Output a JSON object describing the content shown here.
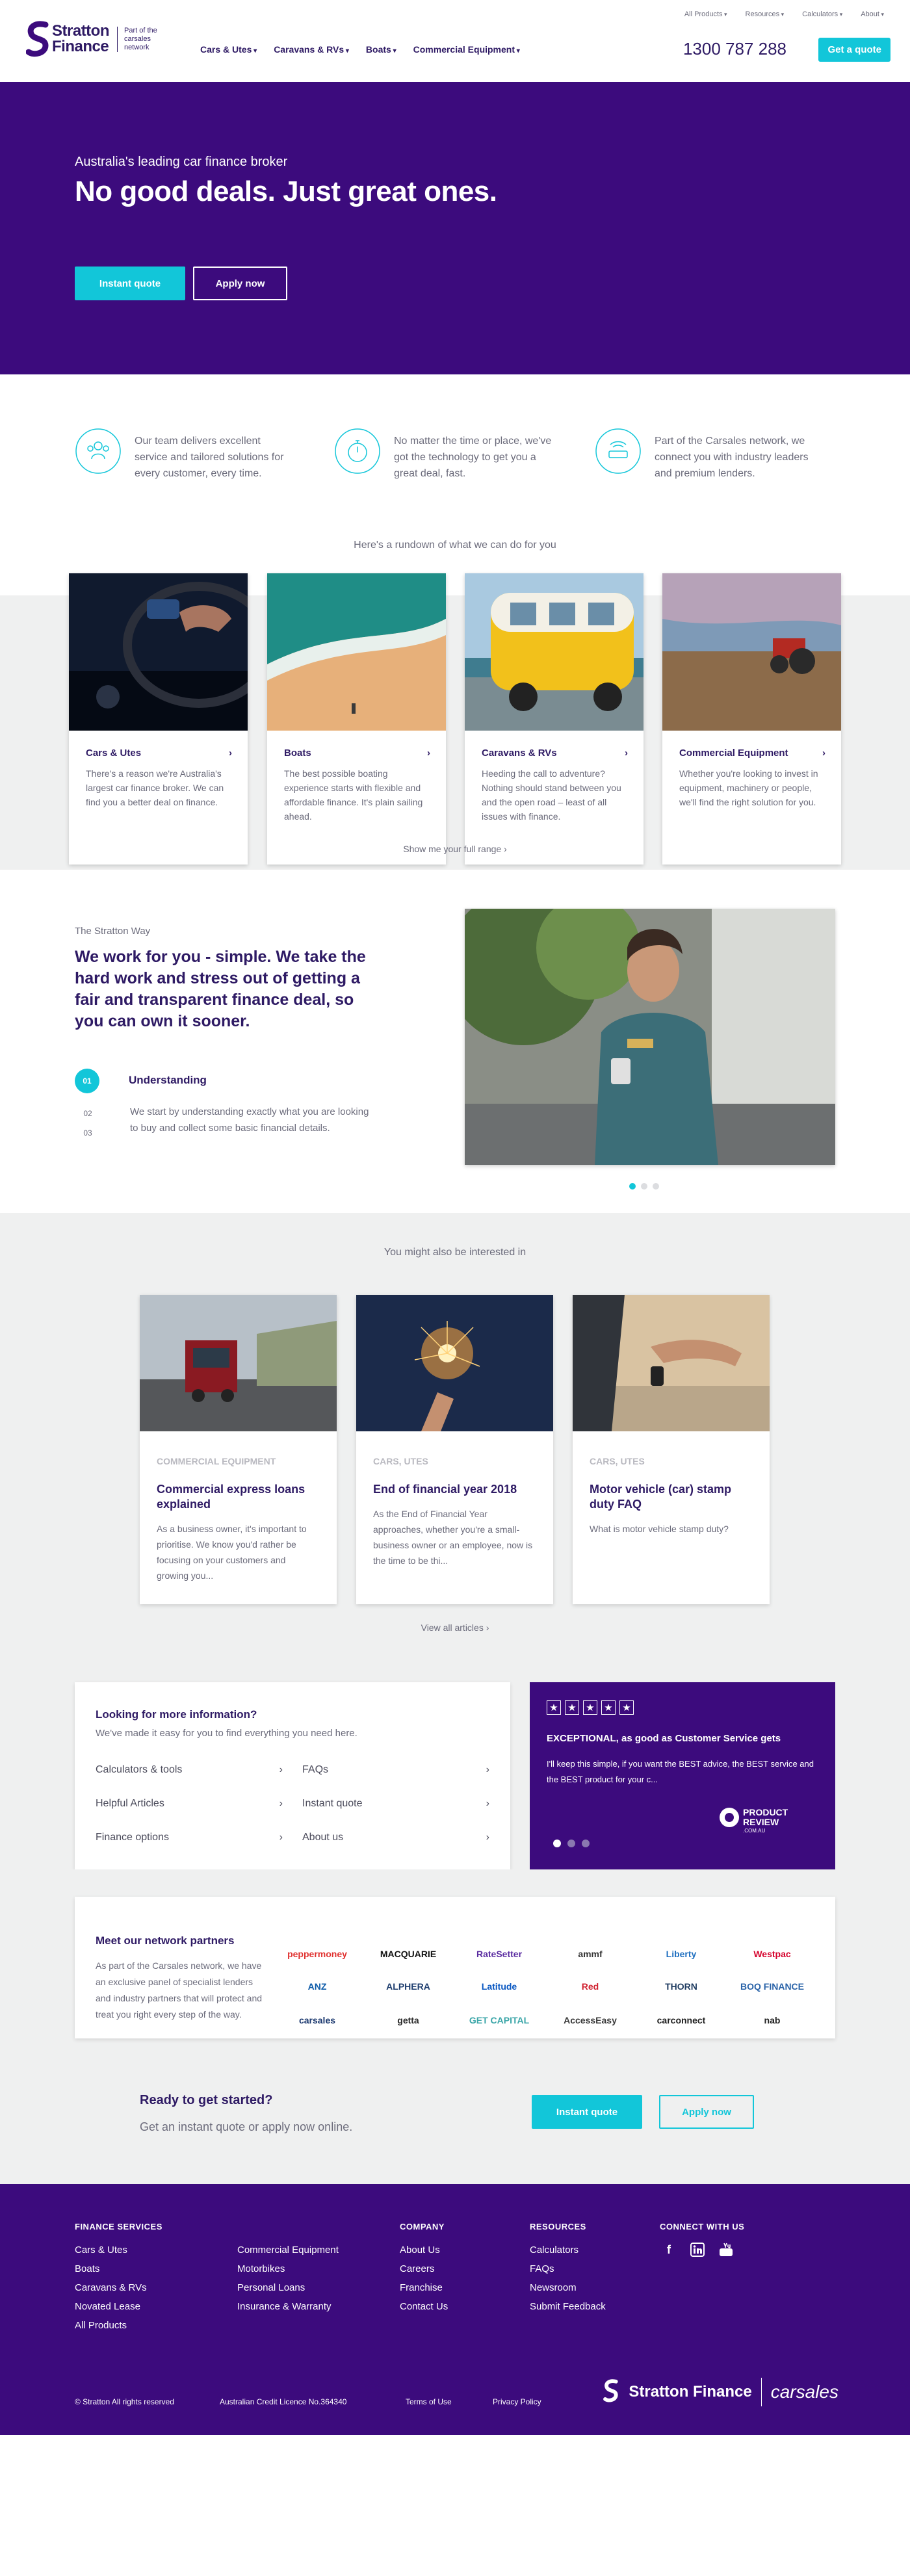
{
  "header": {
    "utility": [
      "All Products",
      "Resources",
      "Calculators",
      "About"
    ],
    "logo_text_1": "Stratton",
    "logo_text_2": "Finance",
    "logo_sub": "Part of the carsales network",
    "nav": [
      {
        "label": "Cars & Utes"
      },
      {
        "label": "Caravans & RVs"
      },
      {
        "label": "Boats"
      },
      {
        "label": "Commercial Equipment"
      }
    ],
    "phone": "1300 787 288",
    "cta": "Get a quote"
  },
  "hero": {
    "kicker": "Australia's leading car finance broker",
    "title": "No good deals. Just great ones.",
    "btn_quote": "Instant quote",
    "btn_apply": "Apply now"
  },
  "features": [
    {
      "icon": "team-icon",
      "text": "Our team delivers excellent service and tailored solutions for every customer, every time."
    },
    {
      "icon": "stopwatch-icon",
      "text": "No matter the time or place, we've got the technology to get you a great deal, fast."
    },
    {
      "icon": "network-icon",
      "text": "Part of the Carsales network, we connect you with industry leaders and premium lenders."
    }
  ],
  "rundown": {
    "title": "Here's a rundown of what we can do for you",
    "cards": [
      {
        "title": "Cars & Utes",
        "desc": "There's a reason we're Australia's largest car finance broker. We can find you a better deal on finance."
      },
      {
        "title": "Boats",
        "desc": "The best possible boating experience starts with flexible and affordable finance. It's plain sailing ahead."
      },
      {
        "title": "Caravans & RVs",
        "desc": "Heeding the call to adventure? Nothing should stand between you and the open road – least of all issues with finance."
      },
      {
        "title": "Commercial Equipment",
        "desc": "Whether you're looking to invest in equipment, machinery or people, we'll find the right solution for you."
      }
    ],
    "more": "Show me your full range ›"
  },
  "way": {
    "kicker": "The Stratton Way",
    "title": "We work for you - simple. We take the hard work and stress out of getting a fair and transparent finance deal, so you can own it sooner.",
    "steps": [
      "01",
      "02",
      "03"
    ],
    "step_title": "Understanding",
    "step_desc": "We start by understanding exactly what you are looking to buy and collect some basic financial details."
  },
  "articles": {
    "title": "You might also be interested in",
    "cards": [
      {
        "tag": "COMMERCIAL EQUIPMENT",
        "title": "Commercial express loans explained",
        "desc": "As a business owner, it's important to prioritise. We know you'd rather be focusing on your customers and growing you..."
      },
      {
        "tag": "CARS, UTES",
        "title": "End of financial year 2018",
        "desc": "As the End of Financial Year approaches, whether you're a small-business owner or an employee, now is the time to be thi..."
      },
      {
        "tag": "CARS, UTES",
        "title": "Motor vehicle (car) stamp duty FAQ",
        "desc": "What is motor vehicle stamp duty?"
      }
    ],
    "view_all": "View all articles ›"
  },
  "info": {
    "title": "Looking for more information?",
    "sub": "We've made it easy for you to find everything you need here.",
    "links": [
      "Calculators & tools",
      "FAQs",
      "Helpful Articles",
      "Instant quote",
      "Finance options",
      "About us"
    ]
  },
  "review": {
    "title": "EXCEPTIONAL, as good as Customer Service gets",
    "text": "I'll keep this simple, if you want the BEST advice, the BEST service and the BEST product for your c...",
    "pr_1": "PRODUCT",
    "pr_2": "REVIEW",
    "pr_3": ".COM.AU"
  },
  "partners": {
    "title": "Meet our network partners",
    "desc": "As part of the Carsales network, we have an exclusive panel of specialist lenders and industry partners that will protect and treat you right every step of the way.",
    "logos": [
      {
        "name": "peppermoney",
        "color": "#e0312f"
      },
      {
        "name": "MACQUARIE",
        "color": "#111111"
      },
      {
        "name": "RateSetter",
        "color": "#5a2ca0"
      },
      {
        "name": "ammf",
        "color": "#333333"
      },
      {
        "name": "Liberty",
        "color": "#1e6fc0"
      },
      {
        "name": "Westpac",
        "color": "#d5002b"
      },
      {
        "name": "ANZ",
        "color": "#0b5aa8"
      },
      {
        "name": "ALPHERA",
        "color": "#1d3d6e"
      },
      {
        "name": "Latitude",
        "color": "#0a58c2"
      },
      {
        "name": "Red",
        "color": "#d0202f"
      },
      {
        "name": "THORN",
        "color": "#1d3a5f"
      },
      {
        "name": "BOQ FINANCE",
        "color": "#2a63a8"
      },
      {
        "name": "carsales",
        "color": "#1d3a70"
      },
      {
        "name": "getta",
        "color": "#2c2c2c"
      },
      {
        "name": "GET CAPITAL",
        "color": "#3aa6a8"
      },
      {
        "name": "AccessEasy",
        "color": "#3a3a3a"
      },
      {
        "name": "carconnect",
        "color": "#222222"
      },
      {
        "name": "nab",
        "color": "#222222"
      }
    ]
  },
  "ready": {
    "title": "Ready to get started?",
    "sub": "Get an instant quote or apply now online.",
    "btn_quote": "Instant quote",
    "btn_apply": "Apply now"
  },
  "footer": {
    "cols": [
      {
        "title": "FINANCE SERVICES",
        "links": [
          "Cars & Utes",
          "Boats",
          "Caravans & RVs",
          "Novated Lease",
          "All Products"
        ]
      },
      {
        "title": "",
        "links": [
          "Commercial Equipment",
          "Motorbikes",
          "Personal Loans",
          "Insurance & Warranty"
        ]
      },
      {
        "title": "COMPANY",
        "links": [
          "About Us",
          "Careers",
          "Franchise",
          "Contact Us"
        ]
      },
      {
        "title": "RESOURCES",
        "links": [
          "Calculators",
          "FAQs",
          "Newsroom",
          "Submit Feedback"
        ]
      }
    ],
    "connect": "CONNECT WITH US",
    "copyright": "© Stratton All rights reserved",
    "licence": "Australian Credit Licence No.364340",
    "terms": "Terms of Use",
    "privacy": "Privacy Policy",
    "logo_text": "Stratton Finance",
    "carsales": "carsales"
  },
  "colors": {
    "brand_purple": "#3c0b7d",
    "accent_cyan": "#12c6d9",
    "navy_text": "#2e1a64"
  }
}
